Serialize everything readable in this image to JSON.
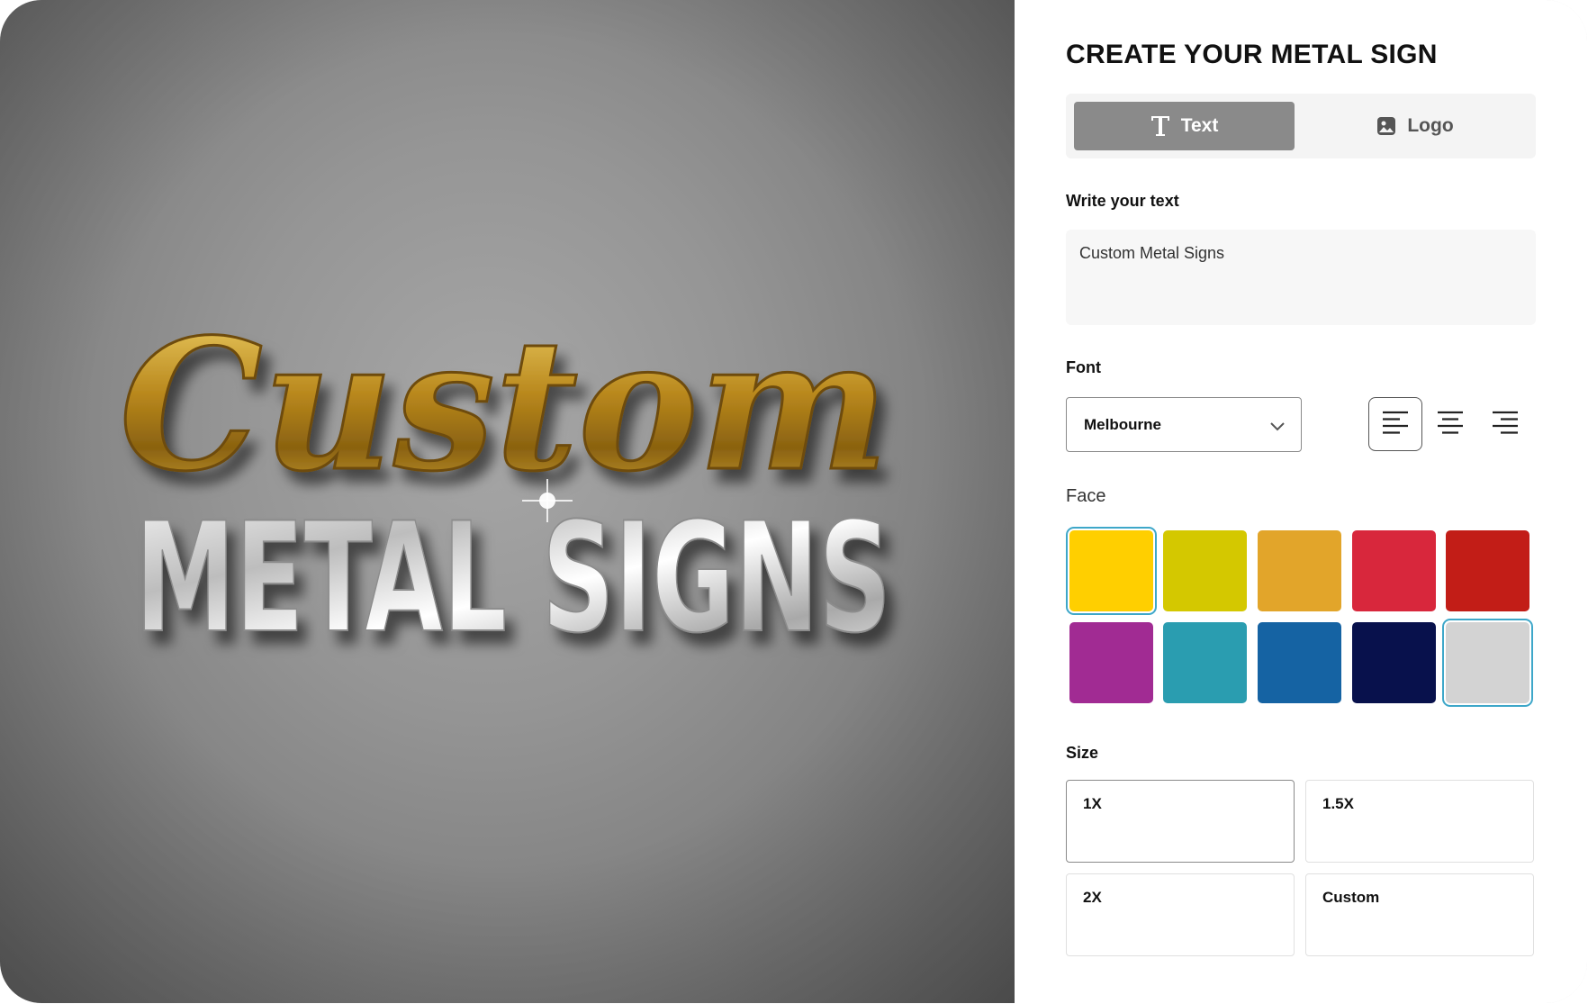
{
  "preview": {
    "script_word": "Custom",
    "block_word": "METAL SIGNS"
  },
  "panel": {
    "title": "CREATE YOUR METAL SIGN",
    "tabs": [
      {
        "label": "Text",
        "icon": "text-t-icon",
        "active": true
      },
      {
        "label": "Logo",
        "icon": "image-icon",
        "active": false
      }
    ],
    "text_section": {
      "label": "Write your text",
      "value": "Custom Metal Signs"
    },
    "font_section": {
      "label": "Font",
      "selected": "Melbourne",
      "alignments": [
        "align-left-icon",
        "align-center-icon",
        "align-right-icon"
      ],
      "active_alignment": "left"
    },
    "face_section": {
      "label": "Face",
      "colors": [
        "#FFCF00",
        "#D4C800",
        "#E2A52A",
        "#D8273C",
        "#C21D17",
        "#A12B93",
        "#2A9DB0",
        "#1563A3",
        "#08114C",
        "#D3D3D3"
      ],
      "selected": [
        "#FFCF00",
        "#D3D3D3"
      ]
    },
    "size_section": {
      "label": "Size",
      "options": [
        "1X",
        "1.5X",
        "2X",
        "Custom"
      ],
      "selected": "1X"
    }
  }
}
